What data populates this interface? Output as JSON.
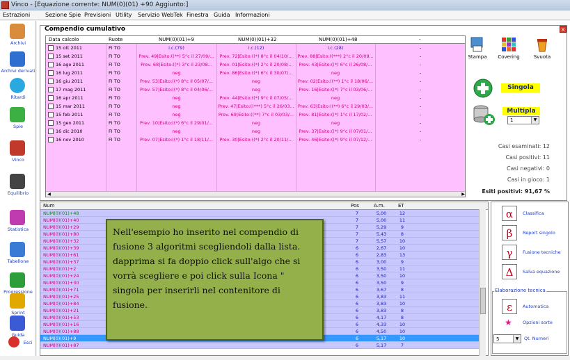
{
  "window": {
    "title": "Vinco - [Equazione corrente: NUM(0)(01) +90 Aggiunto:]"
  },
  "menu": [
    "Estrazioni",
    "Sezione Spie",
    "Previsioni",
    "Utility",
    "Servizio WebTek",
    "Finestra",
    "Guida",
    "Informazioni"
  ],
  "left_toolbar": [
    {
      "label": "Archivi",
      "icon": "pencil-icon",
      "color": "#d98c3c"
    },
    {
      "label": "Archivi derivati",
      "icon": "book-icon",
      "color": "#2f6fd0"
    },
    {
      "label": "Ritardi",
      "icon": "clock-icon",
      "color": "#2aa8e0"
    },
    {
      "label": "Spie",
      "icon": "traffic-light-icon",
      "color": "#3cb043"
    },
    {
      "label": "Vinco",
      "icon": "vinco-logo-icon",
      "color": "#c0392b"
    },
    {
      "label": "Equilibrio",
      "icon": "balance-icon",
      "color": "#444444"
    },
    {
      "label": "Statistica",
      "icon": "chart-icon",
      "color": "#c03ab0"
    },
    {
      "label": "Tabellone",
      "icon": "grid-icon",
      "color": "#3a7bd5"
    },
    {
      "label": "Progressione",
      "icon": "dollar-icon",
      "color": "#2e9e3a"
    },
    {
      "label": "Sprint",
      "icon": "sprint-icon",
      "color": "#e0a800"
    },
    {
      "label": "Guida",
      "icon": "help-book-icon",
      "color": "#3a5bd5"
    },
    {
      "label": "Esci",
      "icon": "exit-icon",
      "color": "#d9302b"
    }
  ],
  "compendio": {
    "title": "Compendio cumulativo",
    "columns": [
      "Data calcolo",
      "Ruote",
      "NUM(0)(01)+9",
      "NUM(0)(01)+32",
      "NUM(0)(01)+48",
      "-"
    ],
    "rows": [
      {
        "date": "15 ott 2011",
        "ruote": "FI TO",
        "c1": "i.c.(79)",
        "c2": "i.c.(12)",
        "c3": "i.c.(28)",
        "c4": "-"
      },
      {
        "date": "15 set 2011",
        "ruote": "FI TO",
        "c1": "Prev. 49|Esito:((**) 5°c il 27/09/...",
        "c2": "Prev. 72|Esito:((*) 8°c il 04/10/...",
        "c3": "Prev. 88|Esito:((***) 2°c il 20/09...",
        "c4": "-"
      },
      {
        "date": "16 ago 2011",
        "ruote": "FI TO",
        "c1": "Prev. 68|Esito:((*) 3°c il 23/08...",
        "c2": "Prev. 01|Esito:((*) 2°c il 20/08/...",
        "c3": "Prev. 43|Esito:((*) 6°c il 26/08/...",
        "c4": "-"
      },
      {
        "date": "16 lug 2011",
        "ruote": "FI TO",
        "c1": "neg",
        "c2": "Prev. 86|Esito:((*) 6°c il 30/07/...",
        "c3": "neg",
        "c4": "-"
      },
      {
        "date": "16 giu 2011",
        "ruote": "FI TO",
        "c1": "Prev. 53|Esito:((*) 8°c il 05/07/...",
        "c2": "neg",
        "c3": "Prev. 02|Esito:((**) 1°c il 18/06/...",
        "c4": "-"
      },
      {
        "date": "17 mag 2011",
        "ruote": "FI TO",
        "c1": "Prev. 57|Esito:((*) 8°c il 04/06/...",
        "c2": "neg",
        "c3": "Prev. 16|Esito:((*) 7°c il 03/06/...",
        "c4": "-"
      },
      {
        "date": "16 apr 2011",
        "ruote": "FI TO",
        "c1": "neg",
        "c2": "Prev. 44|Esito:((*) 9°c il 07/05/...",
        "c3": "neg",
        "c4": "-"
      },
      {
        "date": "15 mar 2011",
        "ruote": "FI TO",
        "c1": "neg",
        "c2": "Prev. 47|Esito:((***) 5°c il 26/03...",
        "c3": "Prev. 63|Esito:((**) 6°c il 29/03/...",
        "c4": "-"
      },
      {
        "date": "15 feb 2011",
        "ruote": "FI TO",
        "c1": "neg",
        "c2": "Prev. 69|Esito:((**) 7°c il 03/03/...",
        "c3": "Prev. 81|Esito:((*) 1°c il 17/02/...",
        "c4": "-"
      },
      {
        "date": "15 gen 2011",
        "ruote": "FI TO",
        "c1": "Prev. 10|Esito:((*) 6°c il 29/01/...",
        "c2": "neg",
        "c3": "neg",
        "c4": "-"
      },
      {
        "date": "16 dic 2010",
        "ruote": "FI TO",
        "c1": "neg",
        "c2": "neg",
        "c3": "Prev. 37|Esito:((*) 9°c il 07/01/...",
        "c4": "-"
      },
      {
        "date": "16 nov 2010",
        "ruote": "FI TO",
        "c1": "Prev. 07|Esito:((*) 1°c il 18/11/...",
        "c2": "Prev. 30|Esito:((*) 2°c il 20/11/...",
        "c3": "Prev. 46|Esito:((*) 9°c il 07/12/...",
        "c4": "-"
      }
    ]
  },
  "tools": {
    "stampa": "Stampa",
    "covering": "Covering",
    "svuota": "Svuota",
    "singola": "Singola",
    "multipla": "Multipla",
    "multipla_value": "1"
  },
  "stats": {
    "esaminati": "Casi esaminati: 12",
    "positivi": "Casi positivi: 11",
    "negativi": "Casi negativi: 0",
    "in_gioco": "Casi in gioco: 1",
    "esiti": "Esiti positivi: 91,67 %"
  },
  "lower_list": {
    "columns": [
      "Num",
      "Pos",
      "A.m.",
      "ET"
    ],
    "rows": [
      {
        "num": "NUM(0)(01)+48",
        "pos": "7",
        "am": "5,00",
        "et": "12"
      },
      {
        "num": "NUM(0)(01)+40",
        "pos": "7",
        "am": "5,00",
        "et": "11"
      },
      {
        "num": "NUM(0)(01)+29",
        "pos": "7",
        "am": "5,29",
        "et": "9"
      },
      {
        "num": "NUM(0)(01)+80",
        "pos": "7",
        "am": "5,43",
        "et": "8"
      },
      {
        "num": "NUM(0)(01)+32",
        "pos": "7",
        "am": "5,57",
        "et": "10"
      },
      {
        "num": "NUM(0)(01)+39",
        "pos": "6",
        "am": "2,67",
        "et": "10"
      },
      {
        "num": "NUM(0)(01)+61",
        "pos": "6",
        "am": "2,83",
        "et": "13"
      },
      {
        "num": "NUM(0)(01)+37",
        "pos": "6",
        "am": "3,00",
        "et": "9"
      },
      {
        "num": "NUM(0)(01)+2",
        "pos": "6",
        "am": "3,50",
        "et": "11"
      },
      {
        "num": "NUM(0)(01)+24",
        "pos": "6",
        "am": "3,50",
        "et": "10"
      },
      {
        "num": "NUM(0)(01)+30",
        "pos": "6",
        "am": "3,50",
        "et": "9"
      },
      {
        "num": "NUM(0)(01)+71",
        "pos": "6",
        "am": "3,67",
        "et": "8"
      },
      {
        "num": "NUM(0)(01)+25",
        "pos": "6",
        "am": "3,83",
        "et": "11"
      },
      {
        "num": "NUM(0)(01)+84",
        "pos": "6",
        "am": "3,83",
        "et": "10"
      },
      {
        "num": "NUM(0)(01)+21",
        "pos": "6",
        "am": "3,83",
        "et": "8"
      },
      {
        "num": "NUM(0)(01)+53",
        "pos": "6",
        "am": "4,17",
        "et": "8"
      },
      {
        "num": "NUM(0)(01)+16",
        "pos": "6",
        "am": "4,33",
        "et": "10"
      },
      {
        "num": "NUM(0)(01)+88",
        "pos": "6",
        "am": "4,50",
        "et": "10"
      },
      {
        "num": "NUM(0)(01)+9",
        "pos": "6",
        "am": "5,17",
        "et": "10"
      },
      {
        "num": "NUM(0)(01)+87",
        "pos": "6",
        "am": "5,17",
        "et": "7"
      }
    ],
    "selected_index": 18
  },
  "note": "Nell'esempio ho inserito nel compendio di fusione 3 algoritmi scegliendoli dalla lista. dapprima si fa doppio click sull'algo che si vorrà scegliere e poi click sulla Icona \" singola per inserirli nel contenitore di fusione.",
  "right_tools": [
    {
      "glyph": "α",
      "label": "Classifica",
      "icon": "alpha-icon"
    },
    {
      "glyph": "β",
      "label": "Report singolo",
      "icon": "beta-icon"
    },
    {
      "glyph": "γ",
      "label": "Fusione tecniche",
      "icon": "gamma-icon"
    },
    {
      "glyph": "Δ",
      "label": "Salva equazione",
      "icon": "delta-icon"
    }
  ],
  "elaborazione": {
    "title": "Elaborazione tecnica",
    "automatica_glyph": "ε",
    "automatica": "Automatica",
    "opzioni": "Opzioni sorte",
    "qt_value": "5",
    "qt_label": "Qt. Numeri"
  }
}
